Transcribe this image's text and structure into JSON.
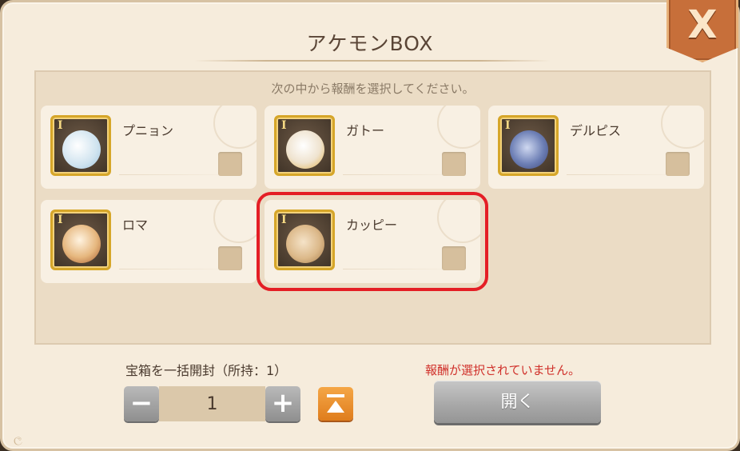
{
  "dialog": {
    "title": "アケモンBOX",
    "instruction": "次の中から報酬を選択してください。",
    "close_label": "X"
  },
  "rewards": [
    {
      "name": "プニョン",
      "rank": "I",
      "icon": "punyon-monster-icon",
      "color": "#cfe3ef",
      "selected": false
    },
    {
      "name": "ガトー",
      "rank": "I",
      "icon": "gateau-monster-icon",
      "color": "#efe3cf",
      "selected": false
    },
    {
      "name": "デルピス",
      "rank": "I",
      "icon": "delpis-monster-icon",
      "color": "#6d7fb5",
      "selected": false
    },
    {
      "name": "ロマ",
      "rank": "I",
      "icon": "roma-monster-icon",
      "color": "#e6b77e",
      "selected": false
    },
    {
      "name": "カッピー",
      "rank": "I",
      "icon": "cappy-monster-icon",
      "color": "#dcb98a",
      "selected": true
    }
  ],
  "bulk": {
    "label": "宝箱を一括開封（所持：1）",
    "quantity": "1",
    "minus": "−",
    "plus": "+"
  },
  "status": {
    "warning": "報酬が選択されていません。"
  },
  "open_button": "開く",
  "colors": {
    "highlight": "#e41e25",
    "accent": "#df7d1d",
    "warning": "#d0302a"
  }
}
